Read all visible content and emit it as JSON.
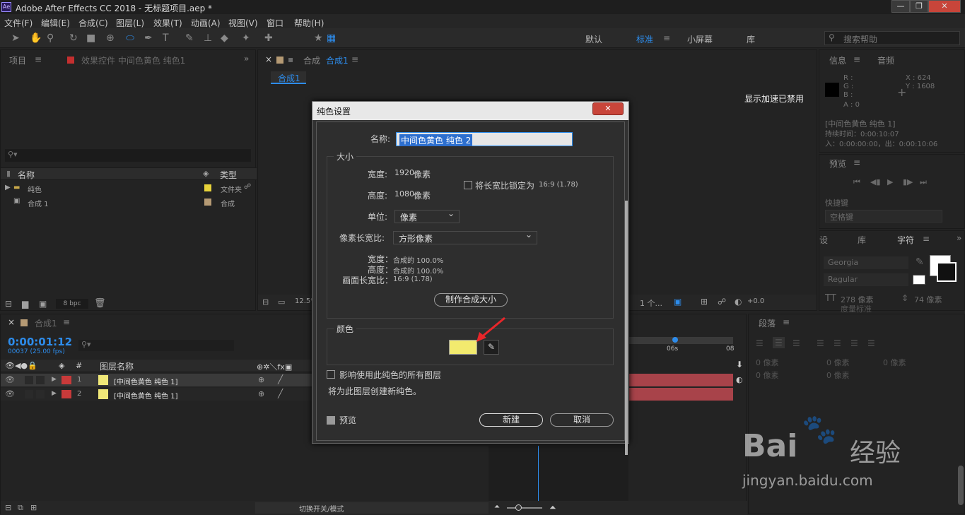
{
  "app": {
    "title": "Adobe After Effects CC 2018 - 无标题项目.aep *",
    "logo": "Ae"
  },
  "menu": [
    "文件(F)",
    "编辑(E)",
    "合成(C)",
    "图层(L)",
    "效果(T)",
    "动画(A)",
    "视图(V)",
    "窗口",
    "帮助(H)"
  ],
  "workspaces": [
    "默认",
    "标准",
    "小屏幕",
    "库"
  ],
  "search_help": "搜索帮助",
  "project_panel": {
    "tab": "项目",
    "fx_tab": "效果控件 中间色黄色 纯色1",
    "col_name": "名称",
    "col_type": "类型",
    "items": [
      {
        "name": "纯色",
        "type": "文件夹",
        "color": "#e8d33a"
      },
      {
        "name": "合成 1",
        "type": "合成",
        "color": "#b59a74"
      }
    ],
    "bpc": "8 bpc"
  },
  "comp_panel": {
    "tab_prefix": "合成",
    "tab_name": "合成1",
    "breadcrumb": "合成1",
    "notice": "显示加速已禁用",
    "zoom": "12.5%",
    "view": "1 个...",
    "exposure": "+0.0"
  },
  "info_panel": {
    "tab1": "信息",
    "tab2": "音频",
    "r": "R :",
    "g": "G :",
    "b": "B :",
    "a": "A : 0",
    "x": "X : 624",
    "y": "Y : 1608",
    "layer": "[中间色黄色 纯色 1]",
    "duration": "持续时间：0:00:10:07",
    "inout": "入：0:00:00:00，出：0:00:10:06"
  },
  "preview_panel": {
    "tab": "预览",
    "shortcut_label": "快捷键",
    "shortcut_value": "空格键"
  },
  "char_panel": {
    "tabs": [
      "设",
      "库",
      "字符"
    ],
    "font": "Georgia",
    "style": "Regular",
    "size": "278 像素",
    "leading": "74 像素",
    "metric": "度量标准"
  },
  "para_panel": {
    "tab": "段落",
    "indent1": "0 像素",
    "indent2": "0 像素",
    "indent3": "0 像素",
    "indent4": "0 像素",
    "indent5": "0 像素"
  },
  "timeline": {
    "tab": "合成1",
    "timecode": "0:00:01:12",
    "frames": "00037 (25.00 fps)",
    "col_layer": "图层名称",
    "col_num": "#",
    "layers": [
      {
        "num": "1",
        "name": "[中间色黄色 纯色 1]",
        "color": "#c83a3a",
        "swatch": "#f0e878"
      },
      {
        "num": "2",
        "name": "[中间色黄色 纯色 1]",
        "color": "#c83a3a",
        "swatch": "#f0e878"
      }
    ],
    "ruler": [
      "06s",
      "08"
    ],
    "footer": "切换开关/模式"
  },
  "dialog": {
    "title": "纯色设置",
    "name_label": "名称:",
    "name_value": "中间色黄色 纯色 2",
    "size_group": "大小",
    "width_label": "宽度:",
    "width_value": "1920",
    "width_unit": "像素",
    "height_label": "高度:",
    "height_value": "1080",
    "height_unit": "像素",
    "lock_label": "将长宽比锁定为",
    "lock_ratio": "16:9 (1.78)",
    "units_label": "单位:",
    "units_value": "像素",
    "par_label": "像素长宽比:",
    "par_value": "方形像素",
    "w_pct_label": "宽度：",
    "w_pct_value": "合成的 100.0%",
    "h_pct_label": "高度：",
    "h_pct_value": "合成的 100.0%",
    "far_label": "画面长宽比：",
    "far_value": "16:9 (1.78)",
    "make_comp_size": "制作合成大小",
    "color_group": "颜色",
    "color_value": "#f2ea6e",
    "affect_label": "影响使用此纯色的所有图层",
    "new_note": "将为此图层创建新纯色。",
    "preview_label": "预览",
    "ok": "新建",
    "cancel": "取消"
  },
  "watermark": {
    "brand": "Bai",
    "brand2": "经验",
    "url": "jingyan.baidu.com"
  }
}
